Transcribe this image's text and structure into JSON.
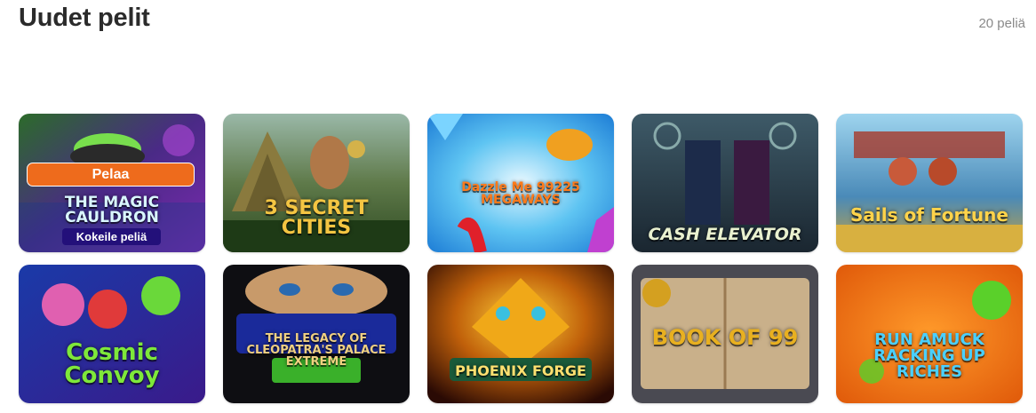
{
  "section": {
    "title": "Uudet pelit",
    "count": "20 peliä"
  },
  "actions": {
    "play_label": "Pelaa",
    "demo_label": "Kokeile peliä"
  },
  "games": [
    {
      "name": "THE MAGIC CAULDRON",
      "id": "magic-cauldron"
    },
    {
      "name": "3 SECRET CITIES",
      "id": "3-secret-cities"
    },
    {
      "name": "Dazzle Me 99225 MEGAWAYS",
      "id": "dazzle-me"
    },
    {
      "name": "CASH ELEVATOR",
      "id": "cash-elevator"
    },
    {
      "name": "Sails of Fortune",
      "id": "sails-of-fortune"
    },
    {
      "name": "Cosmic Convoy",
      "id": "cosmic-convoy"
    },
    {
      "name": "THE LEGACY OF CLEOPATRA'S PALACE EXTREME",
      "id": "cleopatras-palace"
    },
    {
      "name": "PHOENIX FORGE",
      "id": "phoenix-forge"
    },
    {
      "name": "BOOK OF 99",
      "id": "book-of-99"
    },
    {
      "name": "RUN AMUCK RACKING UP RICHES",
      "id": "run-amuck"
    }
  ]
}
